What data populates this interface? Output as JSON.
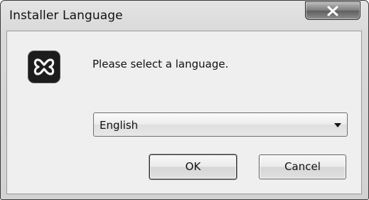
{
  "window": {
    "title": "Installer Language",
    "close_icon": "close-x-icon"
  },
  "dialog": {
    "app_icon": "xampp-logo-icon",
    "prompt": "Please select a language.",
    "language_select": {
      "selected": "English",
      "arrow_icon": "dropdown-arrow-icon"
    },
    "ok_label": "OK",
    "cancel_label": "Cancel"
  }
}
